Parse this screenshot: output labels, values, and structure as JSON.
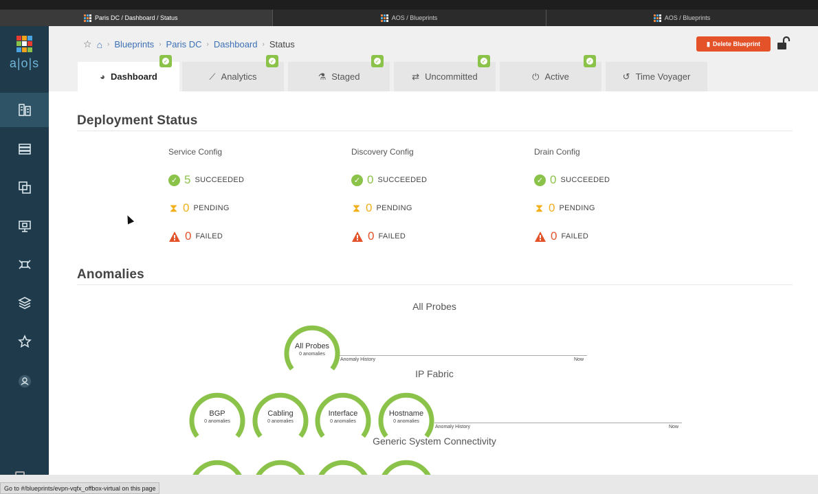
{
  "browser": {
    "tabs": [
      {
        "title": "Paris DC / Dashboard / Status",
        "active": true
      },
      {
        "title": "AOS / Blueprints",
        "active": false
      },
      {
        "title": "AOS / Blueprints",
        "active": false
      }
    ],
    "status_url": "Go to #/blueprints/evpn-vqfx_offbox-virtual on this page"
  },
  "app": {
    "logo_text": "a|o|s",
    "colors": {
      "sidebar": "#1f3a4a",
      "accent_green": "#8bc34a",
      "warning": "#f2b01e",
      "danger": "#e4522a",
      "link": "#3b6fb6"
    }
  },
  "sidebar": {
    "items": [
      {
        "icon": "blueprints-icon",
        "active": true
      },
      {
        "icon": "devices-icon",
        "active": false
      },
      {
        "icon": "design-icon",
        "active": false
      },
      {
        "icon": "resources-icon",
        "active": false
      },
      {
        "icon": "external-systems-icon",
        "active": false
      },
      {
        "icon": "layers-icon",
        "active": false
      },
      {
        "icon": "star-icon",
        "active": false
      },
      {
        "icon": "user-icon",
        "active": false
      }
    ]
  },
  "breadcrumb": {
    "items": [
      "Blueprints",
      "Paris DC",
      "Dashboard"
    ],
    "current": "Status"
  },
  "header": {
    "delete_label": "Delete Blueprint"
  },
  "tabs": [
    {
      "label": "Dashboard",
      "icon": "dashboard-icon",
      "active": true,
      "badge": false
    },
    {
      "label": "Analytics",
      "icon": "analytics-icon",
      "active": false,
      "badge": true
    },
    {
      "label": "Staged",
      "icon": "staged-icon",
      "active": false,
      "badge": true
    },
    {
      "label": "Uncommitted",
      "icon": "uncommitted-icon",
      "active": false,
      "badge": true
    },
    {
      "label": "Active",
      "icon": "power-icon",
      "active": false,
      "badge": true
    },
    {
      "label": "Time Voyager",
      "icon": "history-icon",
      "active": false,
      "badge": true
    }
  ],
  "deployment": {
    "title": "Deployment Status",
    "columns": [
      {
        "title": "Service Config",
        "succeeded": "5",
        "pending": "0",
        "failed": "0"
      },
      {
        "title": "Discovery Config",
        "succeeded": "0",
        "pending": "0",
        "failed": "0"
      },
      {
        "title": "Drain Config",
        "succeeded": "0",
        "pending": "0",
        "failed": "0"
      }
    ],
    "labels": {
      "succeeded": "SUCCEEDED",
      "pending": "PENDING",
      "failed": "FAILED"
    }
  },
  "anomalies": {
    "title": "Anomalies",
    "groups": [
      {
        "title": "All Probes",
        "gauges": [
          {
            "name": "All Probes",
            "sub": "0 anomalies"
          }
        ],
        "history_label": "Anomaly History",
        "now_label": "Now"
      },
      {
        "title": "IP Fabric",
        "gauges": [
          {
            "name": "BGP",
            "sub": "0 anomalies"
          },
          {
            "name": "Cabling",
            "sub": "0 anomalies"
          },
          {
            "name": "Interface",
            "sub": "0 anomalies"
          },
          {
            "name": "Hostname",
            "sub": "0 anomalies"
          }
        ],
        "history_label": "Anomaly History",
        "now_label": "Now"
      },
      {
        "title": "Generic System Connectivity",
        "gauges": []
      }
    ]
  }
}
